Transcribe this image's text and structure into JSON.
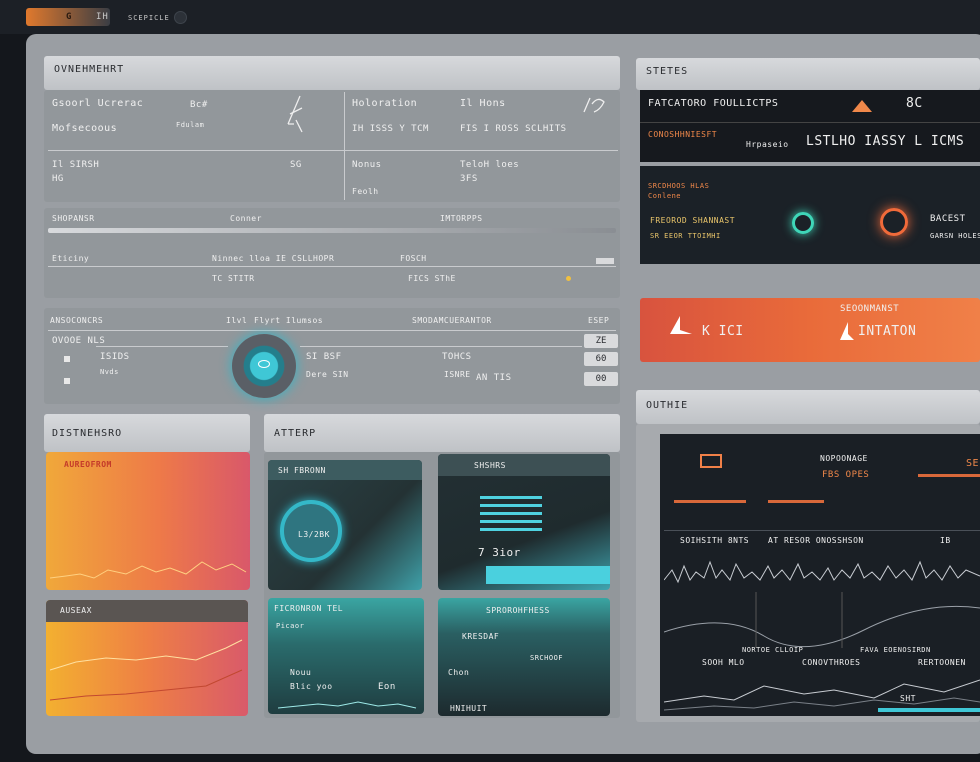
{
  "topbar": {
    "tab": "G",
    "item1": "IH",
    "item2": "SCEPICLE"
  },
  "overview": {
    "title": "OVNEHMEHRT",
    "col1_row1": "Gsoorl Ucrerac",
    "col1_row1_val": "Bc#",
    "col1_row2": "Mofsecoous",
    "col1_row2_val": "Fdulam",
    "col2_row1": "Holoration",
    "col2_row1_val": "Il Hons",
    "col2_row2": "IH ISSS Y TCM",
    "col2_row2_val": "FIS I ROSS SCLHITS",
    "sub1_label": "Il SIRSH",
    "sub1_val": "HG",
    "sub1_right": "SG",
    "sub2_label": "Nonus",
    "sub2_val": "TeloH loes",
    "sub2_right": "3FS",
    "sub2_line2": "Feolh"
  },
  "table": {
    "h1": "SHOPANSR",
    "h2": "Conner",
    "h3": "IMTORPPS",
    "row_label": "Eticiny",
    "row_mid": "Ninnec lloa IE CSLLHOPR",
    "row_right": "FOSCH",
    "row_sub": "TC STITR",
    "row_sub2": "FICS SThE"
  },
  "metrics": {
    "h1": "ANSOCONCRS",
    "h2": "Ilvl",
    "h3": "Flyrt Ilumsos",
    "h4": "SMODAMCUERANTOR",
    "h5": "ESEP",
    "r1": "OVOOE NLS",
    "r2": "ISIDS",
    "r3": "Nvds",
    "r4": "SI BSF",
    "r5": "Dere SIN",
    "r6": "ISNRE",
    "r7": "TOHCS",
    "r8": "AN TIS",
    "b1": "ZE",
    "b2": "60",
    "b3": "00"
  },
  "distress": {
    "title": "DISTNEHSRO",
    "card1": "AUREOFROM",
    "card2": "AUSEAX"
  },
  "attend": {
    "title": "ATTERP",
    "c1": "SH FBRONN",
    "c1_val": "L3/2BK",
    "c2": "SHSHRS",
    "c2_val": "7 3ior",
    "c3": "FICRONRON TEL",
    "c3_a": "Picaor",
    "c3_b": "Nouu",
    "c3_c": "Blic yoo",
    "c3_d": "Eon",
    "c4": "SPROROHFHESS",
    "c4_a": "KRESDAF",
    "c4_b": "SRCHOOF",
    "c4_c": "Chon",
    "c4_d": "HNIHUIT"
  },
  "states": {
    "title": "STETES",
    "banner": "FATCATORO FOULLICTPS",
    "banner_val": "8C",
    "sub_orange": "CONOSHHNIESFT",
    "sub_small": "Hrpaseio",
    "sub_big": "LSTLHO IASSY L ICMS",
    "dark2_a": "SRCDHOOS HLAS",
    "dark2_b": "Conlene",
    "dark2_c": "FREOROD SHANNAST",
    "dark2_d": "SR EEOR TTOIMHI",
    "dark2_e": "BACEST",
    "dark2_f": "GARSN HOLES"
  },
  "alert": {
    "label": "SEOONMANST",
    "left": "K ICI",
    "right": "INTATON"
  },
  "outline": {
    "title": "OUTHIE",
    "chart_top_label": "NOPOONAGE",
    "chart_top_val": "FBS OPES",
    "chart_top_right": "SE",
    "mid_a": "SOIHSITH 8NTS",
    "mid_b": "AT RESOR ONOSSHSON",
    "mid_c": "IB",
    "bottom_a": "NORTOE CLLOIP",
    "bottom_b": "FAVA EOENOSIRDN",
    "bottom_c": "SOOH MLO",
    "bottom_d": "CONOVTHROES",
    "bottom_e": "RERTOONEN",
    "bottom_f": "SHT"
  },
  "colors": {
    "accent": "#e96b3a",
    "teal": "#3fc7d6",
    "panel": "#9a9ea3",
    "dark": "#16191e"
  }
}
